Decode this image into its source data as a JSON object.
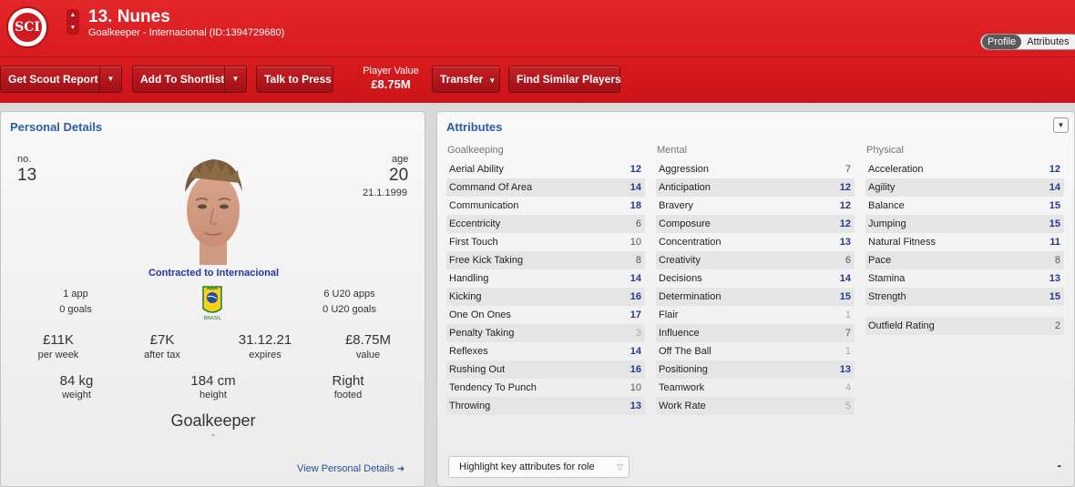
{
  "header": {
    "crest_letters": "SCI",
    "name": "13. Nunes",
    "subtitle": "Goalkeeper - Internacional (ID:1394729680)",
    "tabs": [
      {
        "label": "Profile",
        "active": true
      },
      {
        "label": "Attributes",
        "active": false
      }
    ]
  },
  "toolbar": {
    "scout_report": "Get Scout Report",
    "shortlist": "Add To Shortlist",
    "talk_press": "Talk to Press",
    "player_value_label": "Player Value",
    "player_value": "£8.75M",
    "transfer": "Transfer",
    "find_similar": "Find Similar Players"
  },
  "personal": {
    "title": "Personal Details",
    "no_label": "no.",
    "no_value": "13",
    "age_label": "age",
    "age_value": "20",
    "dob": "21.1.1999",
    "contract": "Contracted to Internacional",
    "apps": "1 app",
    "goals": "0 goals",
    "u20_apps": "6 U20 apps",
    "u20_goals": "0 U20 goals",
    "flag_text": "BRASIL",
    "wage": "£11K",
    "wage_label": "per week",
    "after_tax": "£7K",
    "after_tax_label": "after tax",
    "expires": "31.12.21",
    "expires_label": "expires",
    "value": "£8.75M",
    "value_label": "value",
    "weight": "84 kg",
    "weight_label": "weight",
    "height": "184 cm",
    "height_label": "height",
    "footed": "Right",
    "footed_label": "footed",
    "position": "Goalkeeper",
    "position_sub": "-",
    "view_link": "View Personal Details"
  },
  "attributes": {
    "title": "Attributes",
    "goalkeeping": {
      "heading": "Goalkeeping",
      "rows": [
        {
          "name": "Aerial Ability",
          "value": "12"
        },
        {
          "name": "Command Of Area",
          "value": "14"
        },
        {
          "name": "Communication",
          "value": "18"
        },
        {
          "name": "Eccentricity",
          "value": "6"
        },
        {
          "name": "First Touch",
          "value": "10"
        },
        {
          "name": "Free Kick Taking",
          "value": "8"
        },
        {
          "name": "Handling",
          "value": "14"
        },
        {
          "name": "Kicking",
          "value": "16"
        },
        {
          "name": "One On Ones",
          "value": "17"
        },
        {
          "name": "Penalty Taking",
          "value": "3"
        },
        {
          "name": "Reflexes",
          "value": "14"
        },
        {
          "name": "Rushing Out",
          "value": "16"
        },
        {
          "name": "Tendency To Punch",
          "value": "10"
        },
        {
          "name": "Throwing",
          "value": "13"
        }
      ]
    },
    "mental": {
      "heading": "Mental",
      "rows": [
        {
          "name": "Aggression",
          "value": "7"
        },
        {
          "name": "Anticipation",
          "value": "12"
        },
        {
          "name": "Bravery",
          "value": "12"
        },
        {
          "name": "Composure",
          "value": "12"
        },
        {
          "name": "Concentration",
          "value": "13"
        },
        {
          "name": "Creativity",
          "value": "6"
        },
        {
          "name": "Decisions",
          "value": "14"
        },
        {
          "name": "Determination",
          "value": "15"
        },
        {
          "name": "Flair",
          "value": "1"
        },
        {
          "name": "Influence",
          "value": "7"
        },
        {
          "name": "Off The Ball",
          "value": "1"
        },
        {
          "name": "Positioning",
          "value": "13"
        },
        {
          "name": "Teamwork",
          "value": "4"
        },
        {
          "name": "Work Rate",
          "value": "5"
        }
      ]
    },
    "physical": {
      "heading": "Physical",
      "rows": [
        {
          "name": "Acceleration",
          "value": "12"
        },
        {
          "name": "Agility",
          "value": "14"
        },
        {
          "name": "Balance",
          "value": "15"
        },
        {
          "name": "Jumping",
          "value": "15"
        },
        {
          "name": "Natural Fitness",
          "value": "11"
        },
        {
          "name": "Pace",
          "value": "8"
        },
        {
          "name": "Stamina",
          "value": "13"
        },
        {
          "name": "Strength",
          "value": "15"
        }
      ],
      "outfield_label": "Outfield Rating",
      "outfield_value": "2"
    },
    "highlight_select": "Highlight key attributes for role",
    "dash": "-"
  },
  "colors": {
    "header_red": "#d71a1e",
    "link_blue": "#2b5ea7",
    "value_blue": "#24398e"
  }
}
